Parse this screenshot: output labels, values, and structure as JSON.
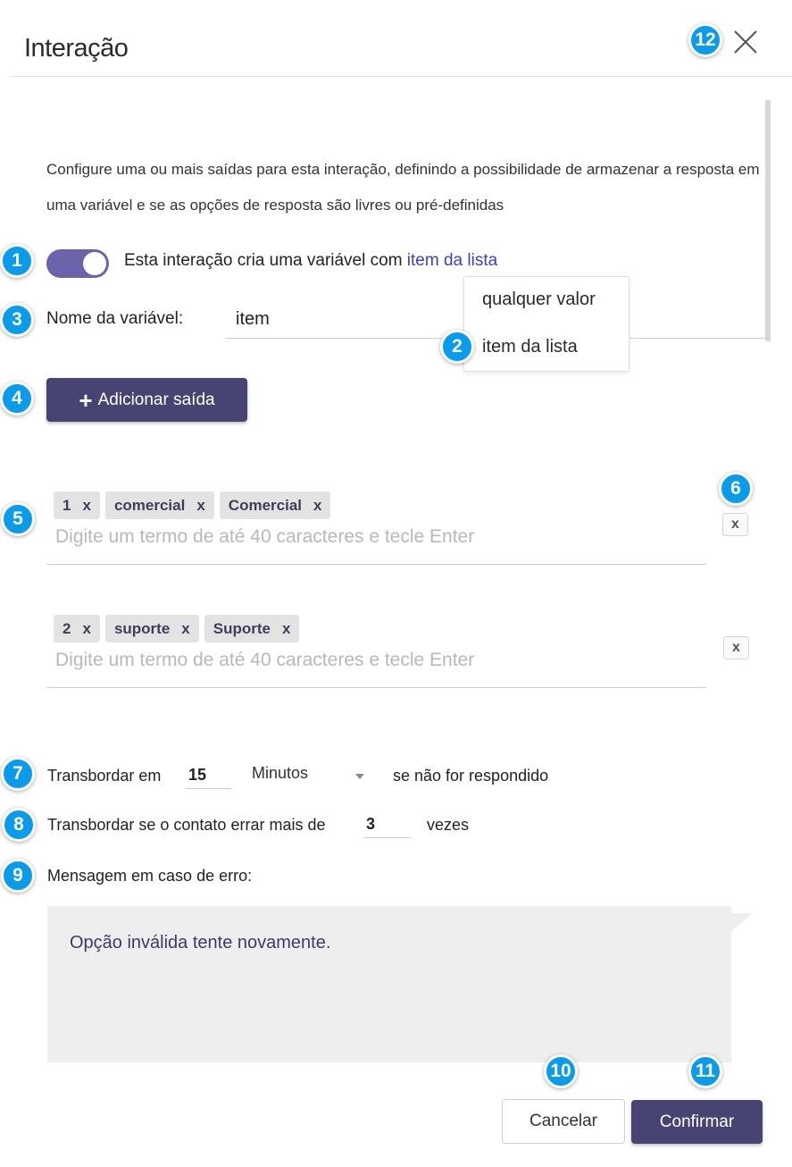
{
  "header": {
    "title": "Interação",
    "close_icon": "close-icon"
  },
  "intro": "Configure uma ou mais saídas para esta interação, definindo a possibilidade de armazenar a resposta em uma variável e se as opções de resposta são livres ou pré-definidas",
  "variable_toggle": {
    "enabled": true,
    "text": "Esta interação cria uma variável com ",
    "link": "item da lista"
  },
  "variable_name": {
    "label": "Nome da variável:",
    "value": "item"
  },
  "type_dropdown": {
    "options": [
      "qualquer valor",
      "item da lista"
    ]
  },
  "add_output_label": "Adicionar saída",
  "outputs": [
    {
      "tags": [
        "1",
        "comercial",
        "Comercial"
      ],
      "placeholder": "Digite um termo de até 40 caracteres e tecle Enter",
      "remove_label": "x"
    },
    {
      "tags": [
        "2",
        "suporte",
        "Suporte"
      ],
      "placeholder": "Digite um termo de até 40 caracteres e tecle Enter",
      "remove_label": "x"
    }
  ],
  "tag_remove_label": "x",
  "overflow_time": {
    "prefix": "Transbordar em",
    "value": "15",
    "unit": "Minutos",
    "suffix": "se não for respondido"
  },
  "overflow_errors": {
    "prefix": "Transbordar se o contato errar mais de",
    "value": "3",
    "suffix": "vezes"
  },
  "error_message": {
    "label": "Mensagem em caso de erro:",
    "text": "Opção inválida tente novamente."
  },
  "footer": {
    "cancel": "Cancelar",
    "confirm": "Confirmar"
  },
  "badges": [
    "1",
    "2",
    "3",
    "4",
    "5",
    "6",
    "7",
    "8",
    "9",
    "10",
    "11",
    "12"
  ],
  "colors": {
    "badge": "#0a9bea",
    "primary": "#474372",
    "toggle": "#6b64ad",
    "link": "#3b3fc4"
  }
}
